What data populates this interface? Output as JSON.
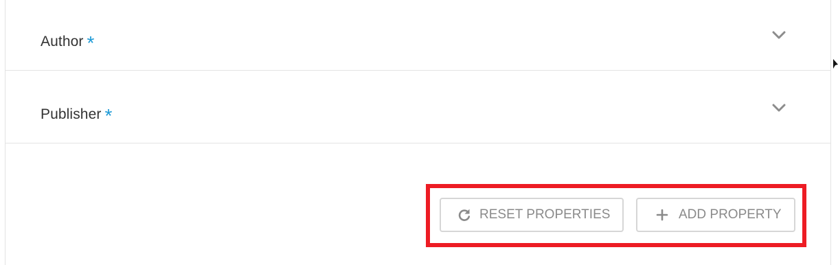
{
  "properties": [
    {
      "label": "Author",
      "required_mark": "*"
    },
    {
      "label": "Publisher",
      "required_mark": "*"
    }
  ],
  "actions": {
    "reset_label": "RESET PROPERTIES",
    "add_label": "ADD PROPERTY"
  },
  "icons": {
    "chevron": "chevron-down-icon",
    "reset": "refresh-icon",
    "add": "plus-icon"
  },
  "colors": {
    "required_accent": "#1e9ad6",
    "highlight_border": "#ed1c24",
    "button_text": "#8a8a8a"
  }
}
